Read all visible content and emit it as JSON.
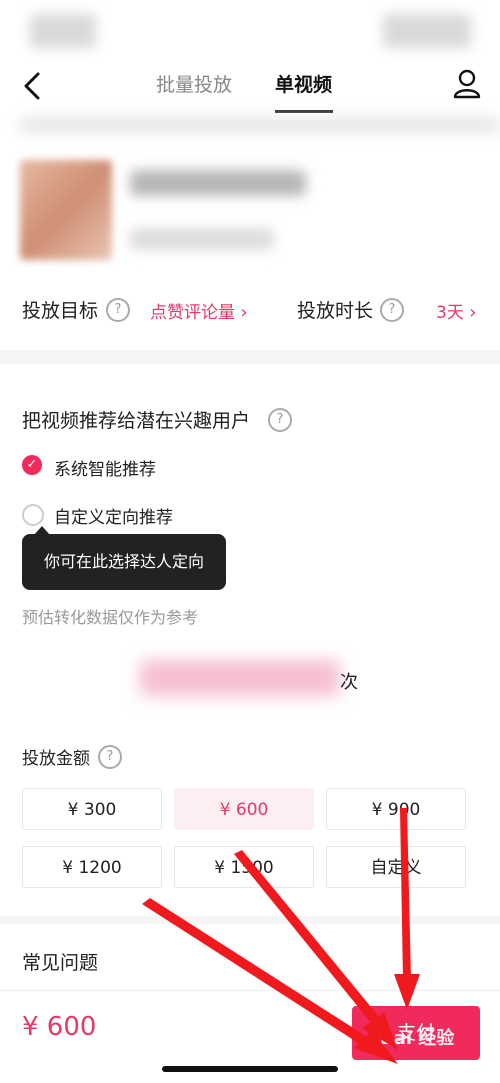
{
  "header": {
    "tabs": [
      {
        "label": "批量投放"
      },
      {
        "label": "单视频"
      }
    ]
  },
  "settings": {
    "goal_label": "投放目标",
    "goal_value": "点赞评论量",
    "duration_label": "投放时长",
    "duration_value": "3天"
  },
  "targeting": {
    "title": "把视频推荐给潜在兴趣用户",
    "option_smart": "系统智能推荐",
    "option_custom": "自定义定向推荐",
    "tooltip": "你可在此选择达人定向",
    "hint": "预估转化数据仅作为参考",
    "estimate_unit": "次"
  },
  "budget": {
    "title": "投放金额",
    "options": [
      "¥ 300",
      "¥ 600",
      "¥ 900",
      "¥ 1200",
      "¥ 1500",
      "自定义"
    ],
    "selected_index": 1
  },
  "faq": {
    "title": "常见问题"
  },
  "footer": {
    "price": "¥ 600",
    "pay_label": "支付"
  },
  "watermark": "Bai 经验",
  "colors": {
    "accent": "#f02a5a",
    "accent_text": "#e43a66"
  }
}
